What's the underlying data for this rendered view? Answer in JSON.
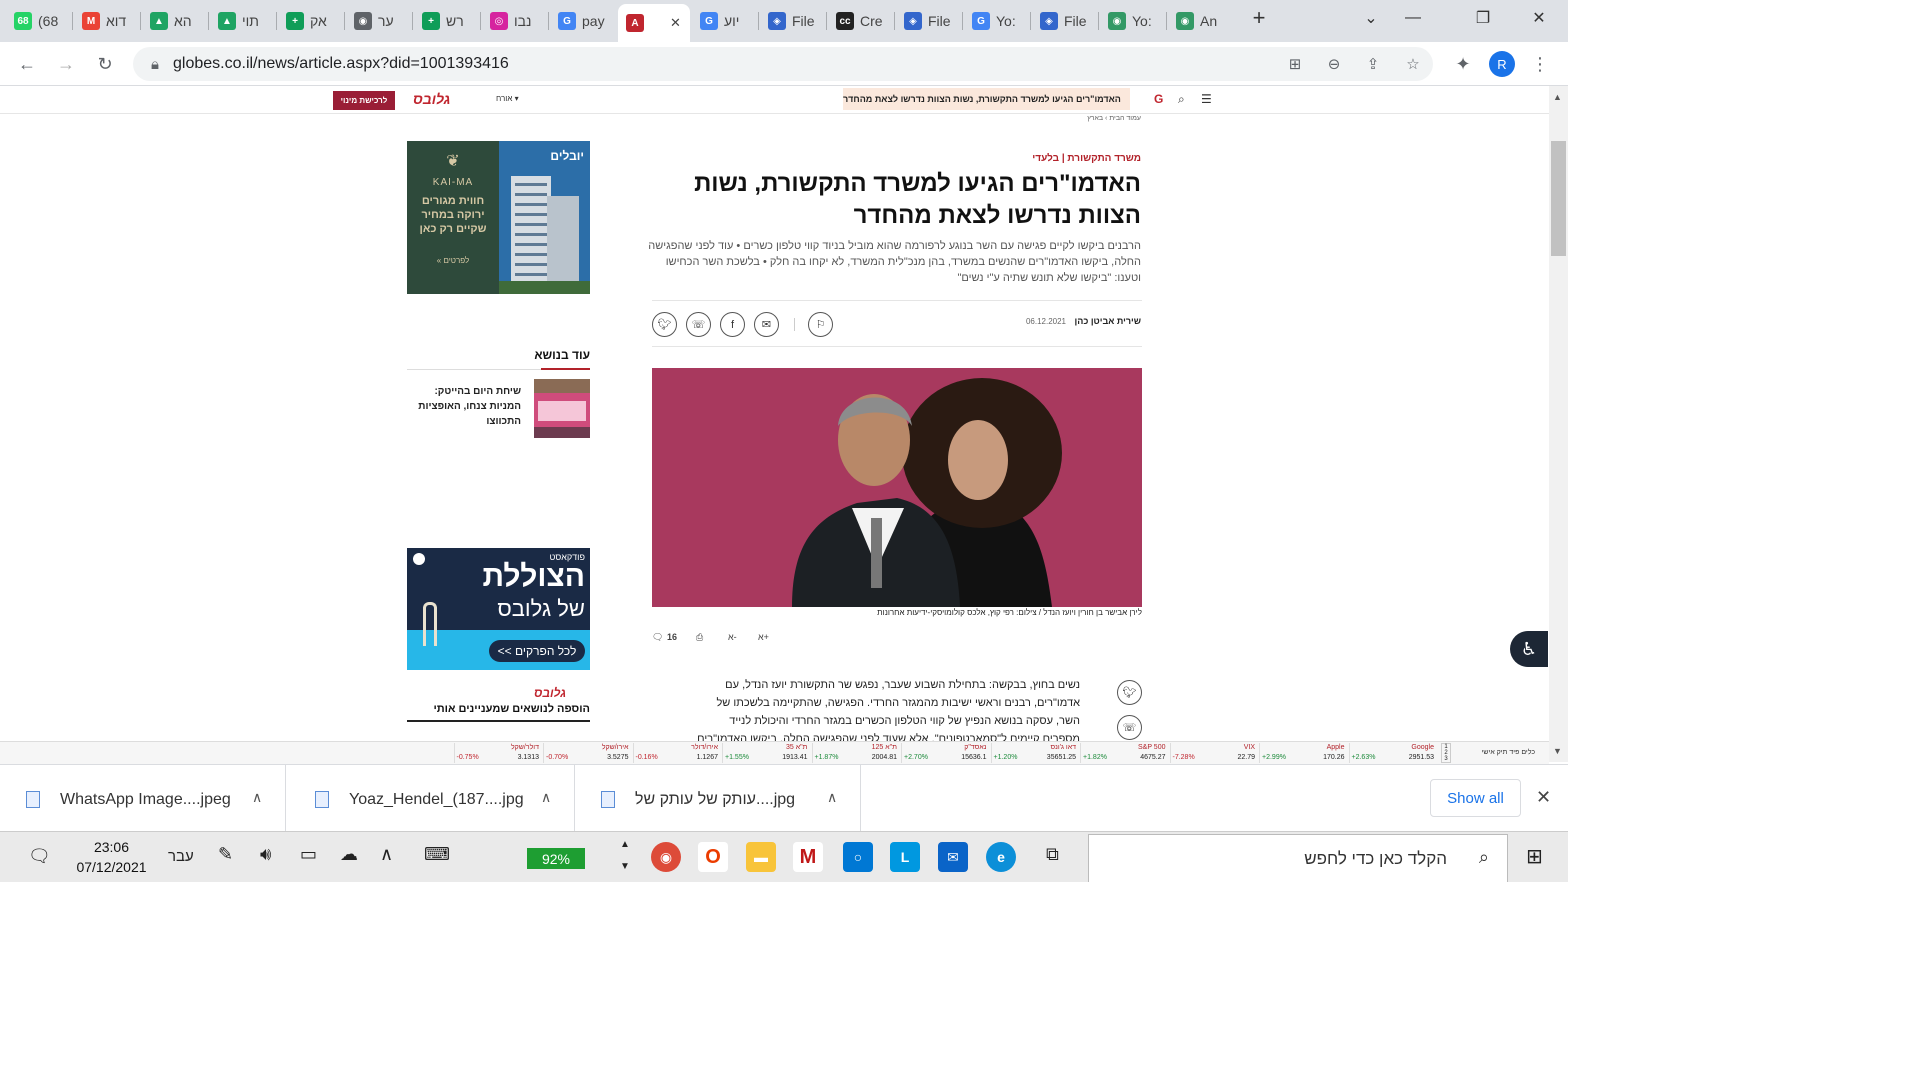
{
  "tabs": [
    {
      "label": "(68",
      "fav": "68",
      "color": "#25d366"
    },
    {
      "label": "דוא",
      "fav": "M",
      "color": "#ea4335"
    },
    {
      "label": "הא",
      "fav": "▲",
      "color": "#1fa463"
    },
    {
      "label": "תוי",
      "fav": "▲",
      "color": "#1fa463"
    },
    {
      "label": "אק",
      "fav": "+",
      "color": "#0f9d58"
    },
    {
      "label": "ער",
      "fav": "◉",
      "color": "#5f6368"
    },
    {
      "label": "רש",
      "fav": "+",
      "color": "#0f9d58"
    },
    {
      "label": "נבו",
      "fav": "◎",
      "color": "#d6249f"
    },
    {
      "label": "pay",
      "fav": "G",
      "color": "#4285f4"
    },
    {
      "label": "",
      "fav": "A",
      "color": "#c0262f",
      "active": true
    },
    {
      "label": "יוע",
      "fav": "G",
      "color": "#4285f4"
    },
    {
      "label": "File",
      "fav": "◈",
      "color": "#3366cc"
    },
    {
      "label": "Cre",
      "fav": "cc",
      "color": "#222222"
    },
    {
      "label": "File",
      "fav": "◈",
      "color": "#3366cc"
    },
    {
      "label": "Yo:",
      "fav": "G",
      "color": "#4285f4"
    },
    {
      "label": "File",
      "fav": "◈",
      "color": "#3366cc"
    },
    {
      "label": "Yo:",
      "fav": "◉",
      "color": "#339966"
    },
    {
      "label": "An",
      "fav": "◉",
      "color": "#339966"
    }
  ],
  "browser": {
    "url": "globes.co.il/news/article.aspx?did=1001393416",
    "profile_initial": "R"
  },
  "site": {
    "subscribe": "לרכישת מינוי",
    "logo": "גלובס",
    "guest": "אורח ▾",
    "ticker": "האדמו\"רים הגיעו למשרד התקשורת, נשות הצוות נדרשו לצאת מהחדר",
    "crumbs": "עמוד הבית  ›  בארץ"
  },
  "article": {
    "kicker": "משרד התקשורת | בלעדי",
    "headline": "האדמו\"רים הגיעו למשרד התקשורת, נשות הצוות נדרשו לצאת מהחדר",
    "subtitle": "הרבנים ביקשו לקיים פגישה עם השר בנוגע לרפורמה שהוא מוביל בניוד קווי טלפון כשרים • עוד לפני שהפגישה החלה, ביקשו האדמו\"רים שהנשים במשרד, בהן מנכ\"לית המשרד, לא יקחו בה חלק • בלשכת השר הכחישו וטענו: \"ביקשו שלא תונש שתיה ע\"י נשים\"",
    "author": "שירית אביטן כהן",
    "date": "06.12.2021",
    "caption": "לירן אבישר בן חורין ויועז הנדל / צילום: רפי קוץ, אלכס קולומויסקי-ידיעות אחרונות",
    "comments": "16",
    "font_up": "א+",
    "font_down": "א-",
    "body": "נשים בחוץ, בבקשה: בתחילת השבוע שעבר, נפגש שר התקשורת יועז הנדל, עם אדמו\"רים, רבנים וראשי ישיבות מהמגזר החרדי. הפגישה, שהתקיימה בלשכתו של השר, עסקה בנושא הנפיץ של קווי הטלפון הכשרים במגזר החרדי והיכולת לנייד מספרים קיימים ל\"סמארטפונים\". אלא שעוד לפני שהפגישה החלה, ביקשו האדמו\"רים שלקחו בה"
  },
  "sidebar": {
    "ad1_brand": "KAI-MA",
    "ad1_text": "חווית מגורים ירוקה במחיר שקיים רק כאן",
    "ad1_cta": "לפרטים »",
    "ad1_right_brand": "יובלים",
    "related_title": "עוד בנושא",
    "related_text": "שיחת היום בהייטק: המניות צנחו, האופציות התכווצו",
    "ad2_tag": "פודקאסט",
    "ad2_title": "הצוללת",
    "ad2_sub": "של גלובס",
    "ad2_btn": "לכל הפרקים >>",
    "logo2": "גלובס",
    "follow": "הוספה לנושאים שמעניינים אותי"
  },
  "market": [
    {
      "name": "Google",
      "value": "2951.53",
      "change": "+2.63%",
      "dir": "up"
    },
    {
      "name": "Apple",
      "value": "170.26",
      "change": "+2.99%",
      "dir": "up"
    },
    {
      "name": "VIX",
      "value": "22.79",
      "change": "-7.28%",
      "dir": "down"
    },
    {
      "name": "S&P 500",
      "value": "4675.27",
      "change": "+1.82%",
      "dir": "up"
    },
    {
      "name": "דאו ג'ונס",
      "value": "35651.25",
      "change": "+1.20%",
      "dir": "up"
    },
    {
      "name": "נאסד\"ק",
      "value": "15636.1",
      "change": "+2.70%",
      "dir": "up"
    },
    {
      "name": "ת\"א 125",
      "value": "2004.81",
      "change": "+1.87%",
      "dir": "up"
    },
    {
      "name": "ת\"א 35",
      "value": "1913.41",
      "change": "+1.55%",
      "dir": "up"
    },
    {
      "name": "אירו/דולר",
      "value": "1.1267",
      "change": "-0.16%",
      "dir": "down"
    },
    {
      "name": "אירו/שקל",
      "value": "3.5275",
      "change": "-0.70%",
      "dir": "down"
    },
    {
      "name": "דולר/שקל",
      "value": "3.1313",
      "change": "-0.75%",
      "dir": "down"
    }
  ],
  "market_links": "כלים   פיד   תיק אישי",
  "downloads": [
    {
      "name": "WhatsApp Image....jpeg"
    },
    {
      "name": "Yoaz_Hendel_(187....jpg"
    },
    {
      "name": "עותק של עותק של....jpg"
    }
  ],
  "downloads_showall": "Show all",
  "taskbar": {
    "time": "23:06",
    "date": "07/12/2021",
    "lang": "עבר",
    "battery": "92%",
    "search": "הקלד כאן כדי לחפש"
  }
}
